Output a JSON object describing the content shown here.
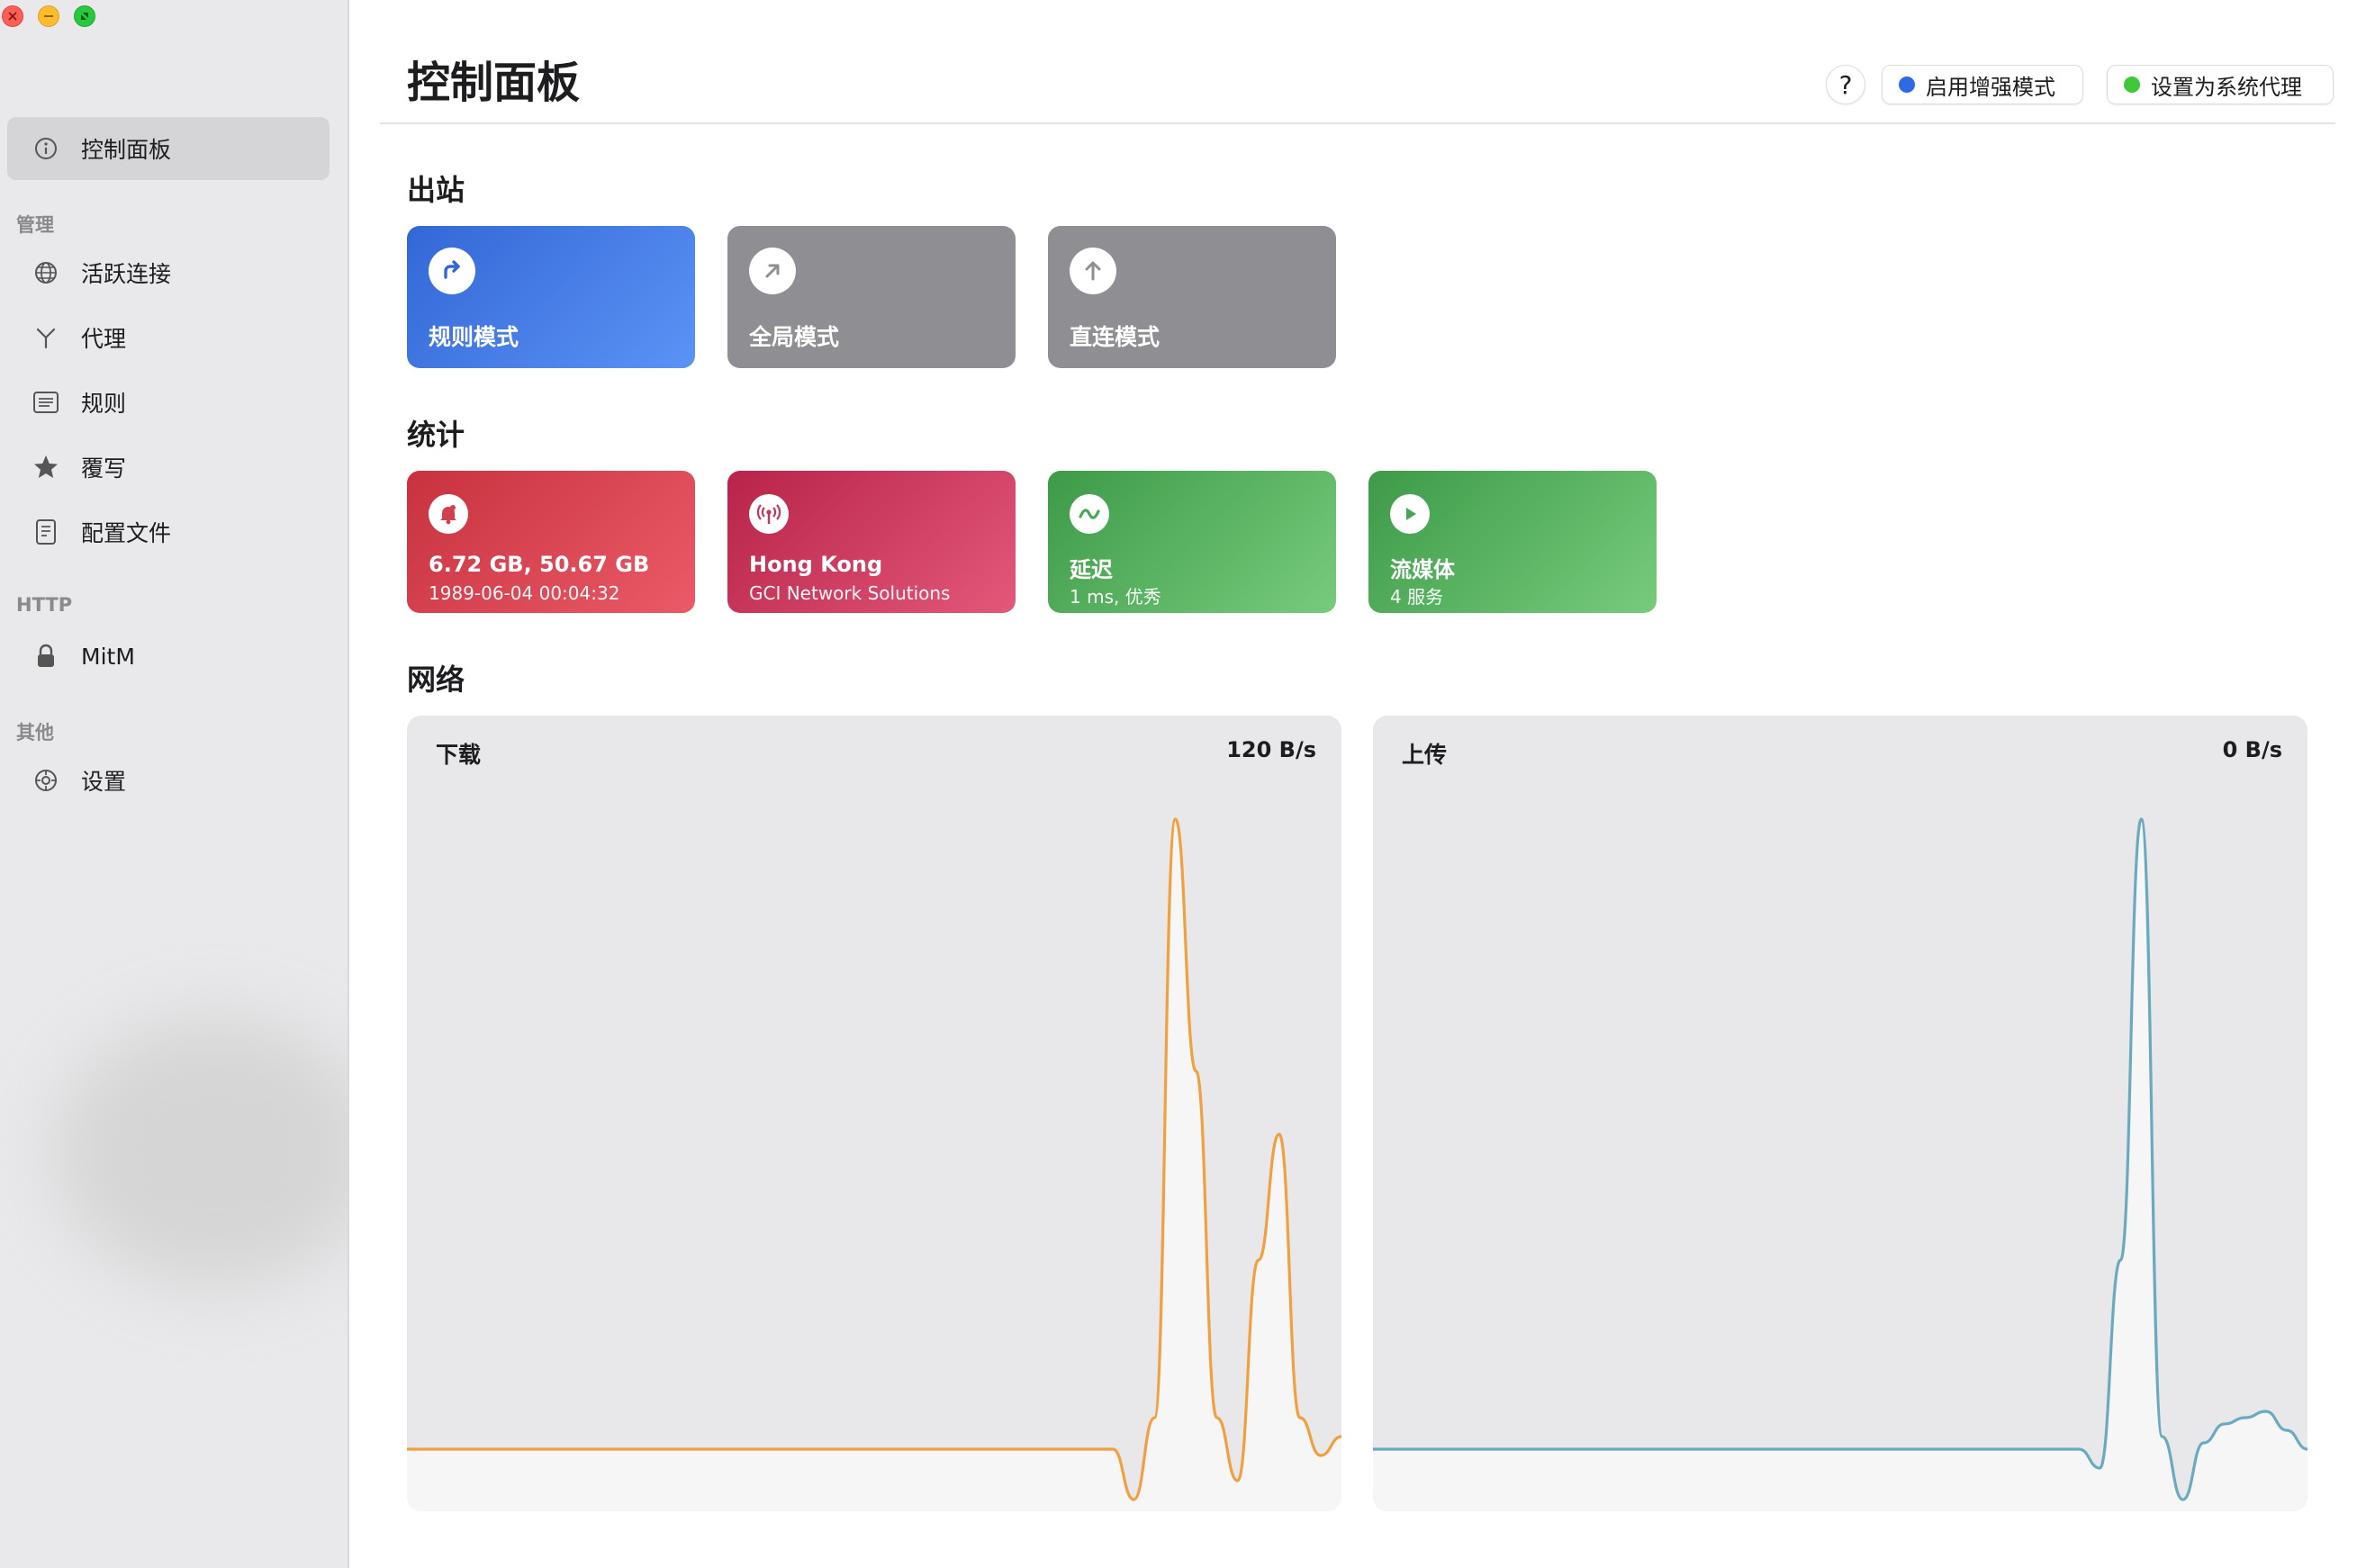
{
  "sidebar": {
    "items": [
      {
        "label": "控制面板",
        "icon": "info-circle-icon",
        "active": true
      },
      {
        "label": "活跃连接",
        "icon": "globe-icon"
      },
      {
        "label": "代理",
        "icon": "proxy-branch-icon"
      },
      {
        "label": "规则",
        "icon": "list-icon"
      },
      {
        "label": "覆写",
        "icon": "star-icon"
      },
      {
        "label": "配置文件",
        "icon": "document-icon"
      },
      {
        "label": "MitM",
        "icon": "lock-icon"
      },
      {
        "label": "设置",
        "icon": "gear-icon"
      }
    ],
    "sections": {
      "manage": "管理",
      "http": "HTTP",
      "other": "其他"
    }
  },
  "header": {
    "title": "控制面板",
    "help_label": "?",
    "enhanced_mode_label": "启用增强模式",
    "system_proxy_label": "设置为系统代理"
  },
  "outbound": {
    "title": "出站",
    "modes": [
      {
        "label": "规则模式",
        "icon": "redirect-arrow-icon",
        "selected": true
      },
      {
        "label": "全局模式",
        "icon": "arrow-up-right-icon",
        "selected": false
      },
      {
        "label": "直连模式",
        "icon": "arrow-up-icon",
        "selected": false
      }
    ]
  },
  "stats": {
    "title": "统计",
    "cards": [
      {
        "title": "6.72 GB, 50.67 GB",
        "subtitle": "1989-06-04 00:04:32",
        "icon": "bell-icon"
      },
      {
        "title": "Hong Kong",
        "subtitle": "GCI Network Solutions",
        "icon": "antenna-icon"
      },
      {
        "title": "延迟",
        "subtitle": "1 ms, 优秀",
        "icon": "wave-icon"
      },
      {
        "title": "流媒体",
        "subtitle": "4 服务",
        "icon": "play-icon"
      }
    ]
  },
  "network": {
    "title": "网络",
    "download": {
      "label": "下载",
      "rate": "120 B/s",
      "color": "#f0a040"
    },
    "upload": {
      "label": "上传",
      "rate": "0 B/s",
      "color": "#6aaac0"
    }
  },
  "colors": {
    "accent": "#3367d6",
    "enhanced_dot": "#2f6ae6",
    "system_proxy_dot": "#3ec83a"
  },
  "chart_data": [
    {
      "type": "line",
      "title": "下载",
      "series": [
        {
          "values": [
            0,
            0,
            0,
            0,
            0,
            0,
            0,
            0,
            0,
            0,
            0,
            0,
            0,
            0,
            0,
            0,
            0,
            0,
            0,
            0,
            0,
            0,
            0,
            0,
            0,
            0,
            0,
            0,
            0,
            0,
            0,
            0,
            0,
            0,
            0,
            -0.08,
            0.05,
            1.0,
            0.6,
            0.05,
            -0.05,
            0.3,
            0.5,
            0.05,
            -0.01,
            0.02
          ]
        }
      ],
      "ylim": [
        -0.1,
        1.05
      ]
    },
    {
      "type": "line",
      "title": "上传",
      "series": [
        {
          "values": [
            0,
            0,
            0,
            0,
            0,
            0,
            0,
            0,
            0,
            0,
            0,
            0,
            0,
            0,
            0,
            0,
            0,
            0,
            0,
            0,
            0,
            0,
            0,
            0,
            0,
            0,
            0,
            0,
            0,
            0,
            0,
            0,
            0,
            0,
            0,
            -0.03,
            0.3,
            1.0,
            0.02,
            -0.08,
            0.01,
            0.04,
            0.05,
            0.06,
            0.03,
            0.0
          ]
        }
      ],
      "ylim": [
        -0.1,
        1.05
      ]
    }
  ]
}
